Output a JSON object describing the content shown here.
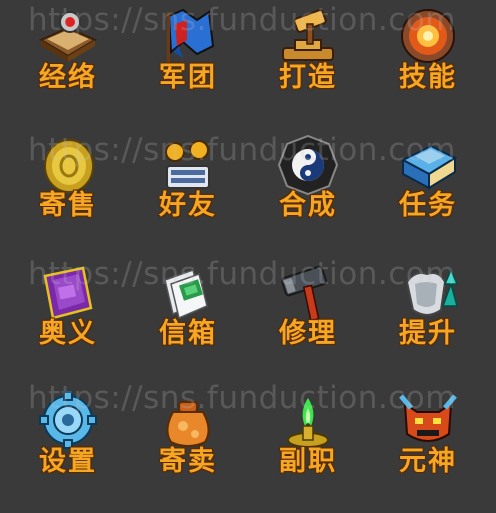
{
  "watermark": "https://sns.funduction.com",
  "menu": {
    "items": [
      {
        "label": "经络"
      },
      {
        "label": "军团"
      },
      {
        "label": "打造"
      },
      {
        "label": "技能"
      },
      {
        "label": "寄售"
      },
      {
        "label": "好友"
      },
      {
        "label": "合成"
      },
      {
        "label": "任务"
      },
      {
        "label": "奥义"
      },
      {
        "label": "信箱"
      },
      {
        "label": "修理"
      },
      {
        "label": "提升"
      },
      {
        "label": "设置"
      },
      {
        "label": "寄卖"
      },
      {
        "label": "副职"
      },
      {
        "label": "元神"
      }
    ]
  },
  "colors": {
    "background": "#3a3a3a",
    "label": "#f5a623"
  }
}
